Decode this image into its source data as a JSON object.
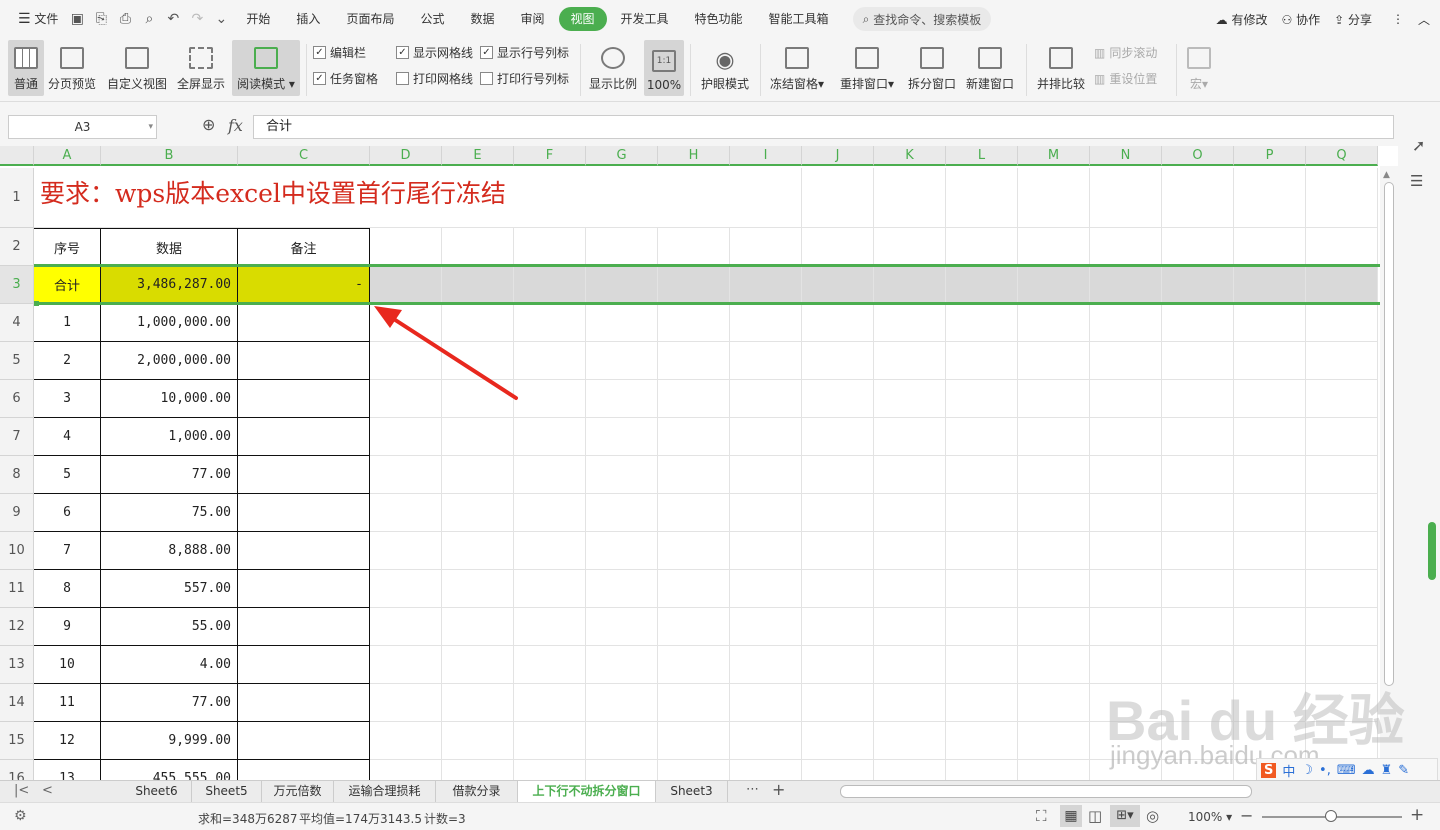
{
  "menubar": {
    "file": "文件",
    "tabs": [
      "开始",
      "插入",
      "页面布局",
      "公式",
      "数据",
      "审阅",
      "视图",
      "开发工具",
      "特色功能",
      "智能工具箱"
    ],
    "active_tab": "视图",
    "search_placeholder": "查找命令、搜索模板",
    "has_changes": "有修改",
    "collab": "协作",
    "share": "分享"
  },
  "ribbon": {
    "normal": "普通",
    "page_break": "分页预览",
    "custom_view": "自定义视图",
    "fullscreen": "全屏显示",
    "reading_mode": "阅读模式",
    "edit_bar": "编辑栏",
    "task_pane": "任务窗格",
    "show_grid": "显示网格线",
    "print_grid": "打印网格线",
    "show_headers": "显示行号列标",
    "print_headers": "打印行号列标",
    "zoom": "显示比例",
    "zoom_100": "100%",
    "eye_care": "护眼模式",
    "freeze": "冻结窗格",
    "arrange": "重排窗口",
    "split": "拆分窗口",
    "new_window": "新建窗口",
    "side_by_side": "并排比较",
    "sync_scroll": "同步滚动",
    "reset_pos": "重设位置",
    "macro": "宏"
  },
  "formula_bar": {
    "name_box": "A3",
    "fx": "fx",
    "value": "合计"
  },
  "sheet": {
    "columns": [
      "A",
      "B",
      "C",
      "D",
      "E",
      "F",
      "G",
      "H",
      "I",
      "J",
      "K",
      "L",
      "M",
      "N",
      "O",
      "P",
      "Q"
    ],
    "rows": [
      "1",
      "2",
      "3",
      "4",
      "5",
      "6",
      "7",
      "8",
      "9",
      "10",
      "11",
      "12",
      "13",
      "14",
      "15",
      "16"
    ],
    "title": "要求：wps版本excel中设置首行尾行冻结",
    "headers": [
      "序号",
      "数据",
      "备注"
    ],
    "total_row": [
      "合计",
      "3,486,287.00",
      "-"
    ],
    "data": [
      [
        "1",
        "1,000,000.00"
      ],
      [
        "2",
        "2,000,000.00"
      ],
      [
        "3",
        "10,000.00"
      ],
      [
        "4",
        "1,000.00"
      ],
      [
        "5",
        "77.00"
      ],
      [
        "6",
        "75.00"
      ],
      [
        "7",
        "8,888.00"
      ],
      [
        "8",
        "557.00"
      ],
      [
        "9",
        "55.00"
      ],
      [
        "10",
        "4.00"
      ],
      [
        "11",
        "77.00"
      ],
      [
        "12",
        "9,999.00"
      ],
      [
        "13",
        "455,555.00"
      ]
    ]
  },
  "sheet_tabs": [
    "Sheet6",
    "Sheet5",
    "万元倍数",
    "运输合理损耗",
    "借款分录",
    "上下行不动拆分窗口",
    "Sheet3"
  ],
  "active_sheet": "上下行不动拆分窗口",
  "status": {
    "sum": "求和=348万6287",
    "avg": "平均值=174万3143.5",
    "count": "计数=3",
    "zoom": "100%"
  },
  "watermark": {
    "brand": "Bai du 经验",
    "url": "jingyan.baidu.com"
  },
  "colors": {
    "accent": "#4bae4f",
    "title_red": "#d42b1e",
    "highlight_yellow": "#ffff00",
    "highlight_olive": "#d9dc00",
    "arrow_red": "#e8281e"
  }
}
